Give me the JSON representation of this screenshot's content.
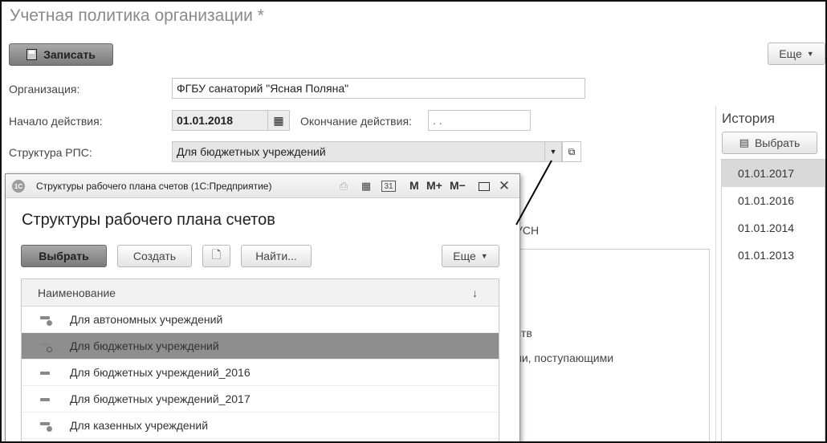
{
  "form": {
    "title": "Учетная политика организации *",
    "save_label": "Записать",
    "more_label": "Еще",
    "fields": {
      "organization_label": "Организация:",
      "organization_value": "ФГБУ санаторий \"Ясная Поляна\"",
      "start_label": "Начало действия:",
      "start_value": "01.01.2018",
      "end_label": "Окончание действия:",
      "end_value": ". .",
      "structure_label": "Структура РПС:",
      "structure_value": "Для бюджетных учреждений"
    }
  },
  "history": {
    "title": "История",
    "select_label": "Выбрать",
    "items": [
      "01.01.2017",
      "01.01.2016",
      "01.01.2014",
      "01.01.2013"
    ],
    "selected_index": 0
  },
  "background": {
    "usn_text": "УСН",
    "partial_1": "ств",
    "partial_2": "ии, поступающими"
  },
  "popup": {
    "window_title": "Структуры рабочего плана счетов  (1С:Предприятие)",
    "logo_text": "1С",
    "m_label": "M",
    "mplus_label": "M+",
    "mminus_label": "M−",
    "heading": "Структуры рабочего плана счетов",
    "select_label": "Выбрать",
    "create_label": "Создать",
    "find_label": "Найти...",
    "more_label": "Еще",
    "column_header": "Наименование",
    "sort_glyph": "↓",
    "rows": [
      {
        "label": "Для автономных учреждений",
        "icon": "group-item-icon"
      },
      {
        "label": "Для бюджетных учреждений",
        "icon": "group-item-icon"
      },
      {
        "label": "Для бюджетных учреждений_2016",
        "icon": "item-icon"
      },
      {
        "label": "Для бюджетных учреждений_2017",
        "icon": "item-icon"
      },
      {
        "label": "Для казенных учреждений",
        "icon": "group-item-icon"
      }
    ],
    "selected_index": 1
  },
  "colors": {
    "selected_row": "#8e8e8e",
    "history_selected": "#d9d9d9",
    "primary_button": "#8a8a8a"
  }
}
